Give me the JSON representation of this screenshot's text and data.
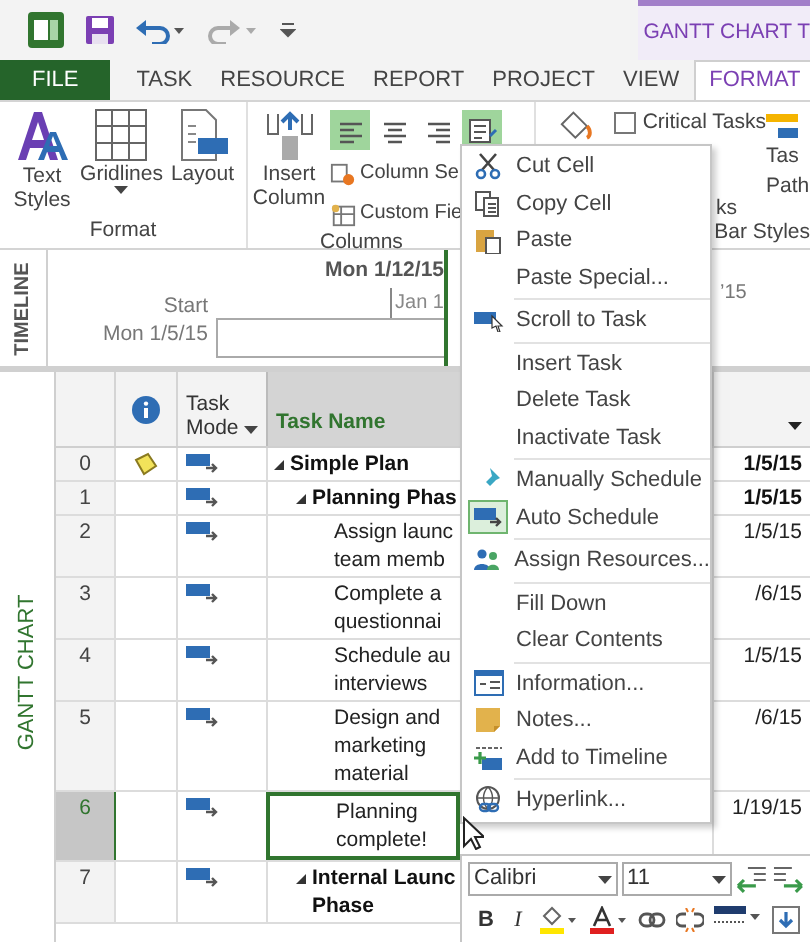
{
  "title_bar": {
    "context_tab": "GANTT CHART T"
  },
  "tabs": [
    {
      "label": "FILE",
      "kind": "file",
      "selected": false
    },
    {
      "label": "TASK",
      "kind": "normal",
      "selected": false
    },
    {
      "label": "RESOURCE",
      "kind": "normal",
      "selected": false
    },
    {
      "label": "REPORT",
      "kind": "normal",
      "selected": false
    },
    {
      "label": "PROJECT",
      "kind": "normal",
      "selected": false
    },
    {
      "label": "VIEW",
      "kind": "normal",
      "selected": false
    },
    {
      "label": "FORMAT",
      "kind": "contextual",
      "selected": true
    }
  ],
  "ribbon": {
    "format_group": {
      "label": "Format",
      "text_styles": "Text Styles",
      "gridlines": "Gridlines",
      "layout": "Layout"
    },
    "columns_group": {
      "label": "Columns",
      "insert_column": "Insert Column",
      "align": [
        {
          "selected": true
        },
        {
          "selected": false
        },
        {
          "selected": false
        },
        {
          "selected": true
        }
      ],
      "column_settings": "Column Se",
      "custom_fields": "Custom Fie"
    },
    "bar_styles_group": {
      "label": "Bar Styles",
      "critical_tasks": {
        "label": "Critical Tasks",
        "checked": false
      },
      "fragment": "ks",
      "task_path": [
        "Tas",
        "Path"
      ]
    }
  },
  "timeline": {
    "label": "TIMELINE",
    "date_top": "Mon 1/12/15",
    "tick": "Jan 1",
    "tick_right": "’15",
    "start_label": "Start",
    "start_date": "Mon 1/5/15"
  },
  "gantt": {
    "label": "GANTT CHART",
    "columns": {
      "mode": [
        "Task",
        "Mode"
      ],
      "name": "Task Name"
    },
    "tasks": [
      {
        "id": "0",
        "name": "Simple Plan",
        "kind": "summary",
        "start": "1/5/15",
        "note": true,
        "selected": false,
        "children": [
          {
            "id": "1",
            "name": "Planning Phas",
            "kind": "summary",
            "start": "1/5/15",
            "note": false,
            "selected": false,
            "children": [
              {
                "id": "2",
                "name": "Assign launc\nteam memb",
                "kind": "task",
                "start": "1/5/15",
                "note": false,
                "selected": false
              },
              {
                "id": "3",
                "name": "Complete a\nquestionnai",
                "kind": "task",
                "start": "/6/15",
                "note": false,
                "selected": false
              },
              {
                "id": "4",
                "name": "Schedule au\ninterviews",
                "kind": "task",
                "start": "1/5/15",
                "note": false,
                "selected": false
              },
              {
                "id": "5",
                "name": "Design and\nmarketing\nmaterial",
                "kind": "task",
                "start": "/6/15",
                "note": false,
                "selected": false
              },
              {
                "id": "6",
                "name": "Planning\ncomplete!",
                "kind": "task",
                "start": "1/19/15",
                "note": false,
                "selected": true
              }
            ]
          },
          {
            "id": "7",
            "name": "Internal Launc\nPhase",
            "kind": "summary",
            "note": false,
            "selected": false
          }
        ]
      }
    ]
  },
  "context_menu": {
    "groups": [
      [
        {
          "label": "Cut Cell",
          "checked": false
        },
        {
          "label": "Copy Cell",
          "checked": false
        },
        {
          "label": "Paste",
          "checked": false
        },
        {
          "label": "Paste Special...",
          "checked": false
        }
      ],
      [
        {
          "label": "Scroll to Task",
          "checked": false
        }
      ],
      [
        {
          "label": "Insert Task",
          "checked": false
        },
        {
          "label": "Delete Task",
          "checked": false
        },
        {
          "label": "Inactivate Task",
          "checked": false
        }
      ],
      [
        {
          "label": "Manually Schedule",
          "checked": false
        },
        {
          "label": "Auto Schedule",
          "checked": true
        }
      ],
      [
        {
          "label": "Assign Resources...",
          "checked": false
        }
      ],
      [
        {
          "label": "Fill Down",
          "checked": false
        },
        {
          "label": "Clear Contents",
          "checked": false
        }
      ],
      [
        {
          "label": "Information...",
          "checked": false
        },
        {
          "label": "Notes...",
          "checked": false
        },
        {
          "label": "Add to Timeline",
          "checked": false
        }
      ],
      [
        {
          "label": "Hyperlink...",
          "checked": false
        }
      ]
    ]
  },
  "mini_toolbar": {
    "font": "Calibri",
    "size": "11",
    "bold": "B",
    "italic": "I"
  }
}
